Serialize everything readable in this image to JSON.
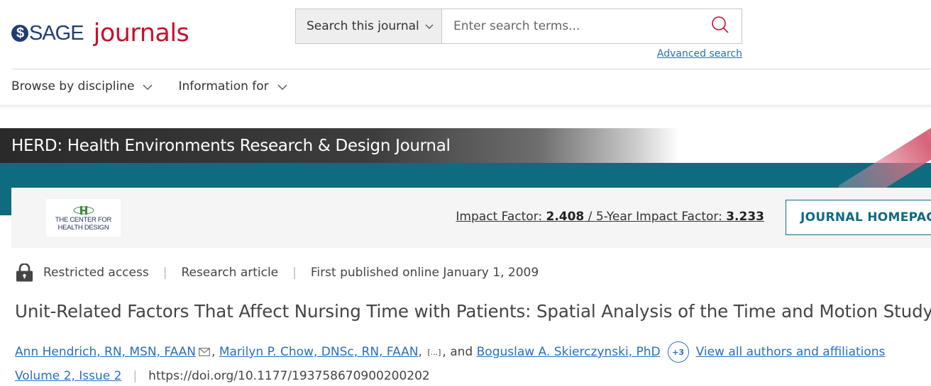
{
  "header": {
    "logo_sage": "SAGE",
    "logo_journals": "journals",
    "search_scope": "Search this journal",
    "search_placeholder": "Enter search terms...",
    "advanced_search": "Advanced search"
  },
  "nav": {
    "items": [
      {
        "label": "Browse by discipline"
      },
      {
        "label": "Information for"
      }
    ]
  },
  "banner": {
    "journal_title": "HERD: Health Environments Research & Design Journal"
  },
  "journal_info": {
    "logo_line1": "The Center for",
    "logo_line2": "Health Design",
    "impact_label": "Impact Factor: ",
    "impact_value": "2.408",
    "impact_sep": " / ",
    "five_year_label": "5-Year Impact Factor: ",
    "five_year_value": "3.233",
    "homepage_button": "JOURNAL HOMEPAGE"
  },
  "article": {
    "access": "Restricted access",
    "type": "Research article",
    "published": "First published online January 1, 2009",
    "title": "Unit-Related Factors That Affect Nursing Time with Patients: Spatial Analysis of the Time and Motion Study",
    "authors": [
      "Ann Hendrich, RN, MSN, FAAN",
      "Marilyn P. Chow, DNSc, RN, FAAN",
      "Boguslaw A. Skierczynski, PhD"
    ],
    "ellipsis": "[...]",
    "and_text": "and",
    "more_authors_badge": "+3",
    "view_all_authors": "View all authors and affiliations",
    "volume_issue": "Volume 2, Issue 2",
    "doi": "https://doi.org/10.1177/193758670900200202"
  },
  "colors": {
    "brand_blue": "#1f3c73",
    "brand_red": "#c8102e",
    "teal": "#0f6b80",
    "link": "#2a6ebb"
  }
}
